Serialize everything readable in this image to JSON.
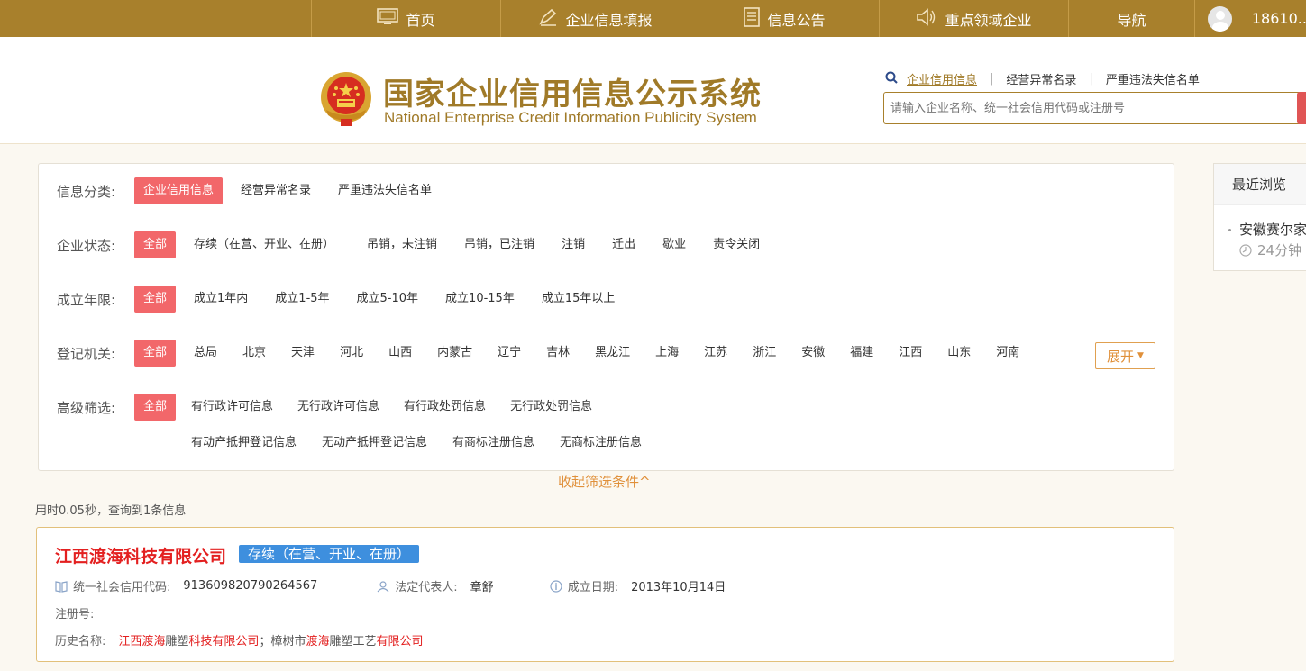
{
  "topnav": {
    "tabs": [
      {
        "label": "首页",
        "icon": "monitor-icon"
      },
      {
        "label": "企业信息填报",
        "icon": "pen-icon"
      },
      {
        "label": "信息公告",
        "icon": "document-icon"
      },
      {
        "label": "重点领域企业",
        "icon": "speaker-icon"
      },
      {
        "label": "导航",
        "icon": ""
      }
    ],
    "user": "18610..."
  },
  "header": {
    "title_cn": "国家企业信用信息公示系统",
    "title_en": "National Enterprise Credit Information Publicity System",
    "search_links": [
      "企业信用信息",
      "经营异常名录",
      "严重违法失信名单"
    ],
    "search_placeholder": "请输入企业名称、统一社会信用代码或注册号"
  },
  "filters": {
    "info_category": {
      "label": "信息分类:",
      "options": [
        "企业信用信息",
        "经营异常名录",
        "严重违法失信名单"
      ]
    },
    "status": {
      "label": "企业状态:",
      "options": [
        "全部",
        "存续（在营、开业、在册）",
        "吊销，未注销",
        "吊销，已注销",
        "注销",
        "迁出",
        "歇业",
        "责令关闭"
      ]
    },
    "years": {
      "label": "成立年限:",
      "options": [
        "全部",
        "成立1年内",
        "成立1-5年",
        "成立5-10年",
        "成立10-15年",
        "成立15年以上"
      ]
    },
    "authority": {
      "label": "登记机关:",
      "options": [
        "全部",
        "总局",
        "北京",
        "天津",
        "河北",
        "山西",
        "内蒙古",
        "辽宁",
        "吉林",
        "黑龙江",
        "上海",
        "江苏",
        "浙江",
        "安徽",
        "福建",
        "江西",
        "山东",
        "河南"
      ],
      "expand": "展开"
    },
    "advanced": {
      "label": "高级筛选:",
      "options": [
        "全部",
        "有行政许可信息",
        "无行政许可信息",
        "有行政处罚信息",
        "无行政处罚信息"
      ],
      "options2": [
        "有动产抵押登记信息",
        "无动产抵押登记信息",
        "有商标注册信息",
        "无商标注册信息"
      ]
    },
    "collapse": "收起筛选条件^"
  },
  "result_meta": "用时0.05秒，查询到1条信息",
  "result": {
    "name": "江西渡海科技有限公司",
    "status": "存续（在营、开业、在册）",
    "credit_code_label": "统一社会信用代码:",
    "credit_code": "913609820790264567",
    "legal_rep_label": "法定代表人:",
    "legal_rep": "章舒",
    "est_date_label": "成立日期:",
    "est_date": "2013年10月14日",
    "reg_no_label": "注册号:",
    "history_label": "历史名称:",
    "history_1a": "江西渡海",
    "history_1b": "雕塑",
    "history_1c": "科技有限公司",
    "history_sep": "；",
    "history_2a": "樟树市",
    "history_2b": "渡海",
    "history_2c": "雕塑工艺",
    "history_2d": "有限公司"
  },
  "recent": {
    "title": "最近浏览",
    "item": "安徽赛尔家",
    "time": "24分钟"
  }
}
